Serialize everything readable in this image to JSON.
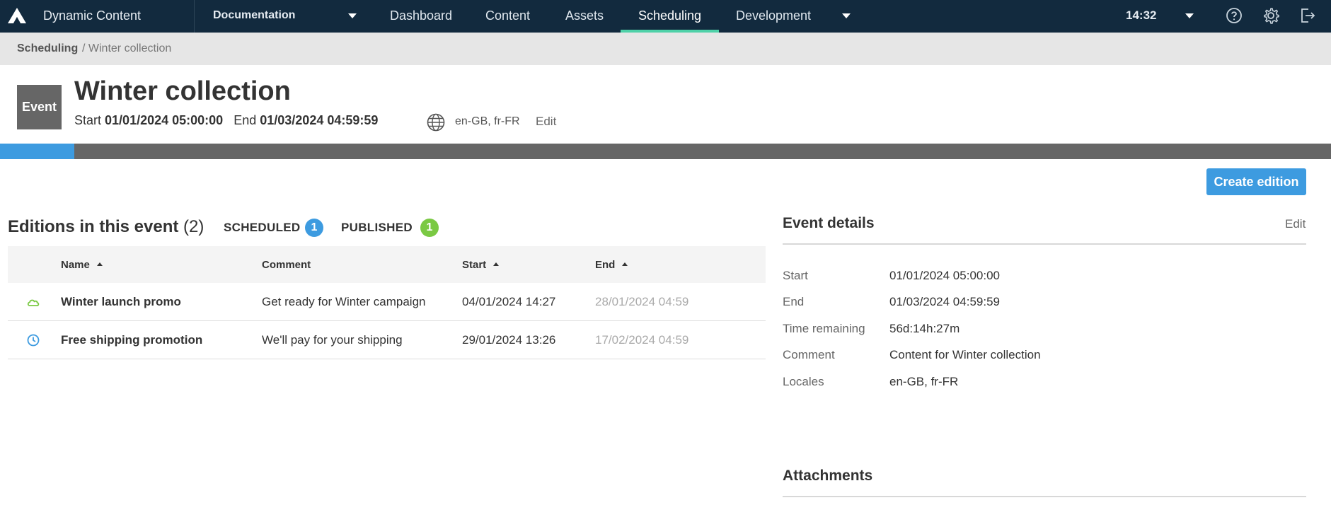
{
  "topbar": {
    "logo_icon": "amplience-logo-icon",
    "app_name": "Dynamic Content",
    "hub_name": "Documentation",
    "nav": [
      {
        "label": "Dashboard",
        "active": false
      },
      {
        "label": "Content",
        "active": false
      },
      {
        "label": "Assets",
        "active": false
      },
      {
        "label": "Scheduling",
        "active": true
      },
      {
        "label": "Development",
        "active": false
      }
    ],
    "clock": "14:32",
    "icons": [
      "help-icon",
      "settings-icon",
      "logout-icon"
    ]
  },
  "breadcrumb": {
    "root": "Scheduling",
    "current": "/ Winter collection"
  },
  "event": {
    "badge": "Event",
    "title": "Winter collection",
    "start_label": "Start",
    "start_value": "01/01/2024 05:00:00",
    "end_label": "End",
    "end_value": "01/03/2024 04:59:59",
    "locales": "en-GB, fr-FR",
    "edit_label": "Edit",
    "elapsed_fraction": 0.056
  },
  "actions": {
    "create_edition": "Create edition"
  },
  "editions": {
    "title": "Editions in this event",
    "count": "(2)",
    "scheduled_label": "SCHEDULED",
    "scheduled_count": "1",
    "published_label": "PUBLISHED",
    "published_count": "1",
    "columns": {
      "name": "Name",
      "comment": "Comment",
      "start": "Start",
      "end": "End"
    },
    "rows": [
      {
        "status_icon": "cloud-published-icon",
        "name": "Winter launch promo",
        "comment": "Get ready for Winter campaign",
        "start": "04/01/2024 14:27",
        "end": "28/01/2024 04:59"
      },
      {
        "status_icon": "clock-scheduled-icon",
        "name": "Free shipping promotion",
        "comment": "We'll pay for your shipping",
        "start": "29/01/2024 13:26",
        "end": "17/02/2024 04:59"
      }
    ]
  },
  "details": {
    "title": "Event details",
    "edit_label": "Edit",
    "items": [
      {
        "label": "Start",
        "value": "01/01/2024 05:00:00"
      },
      {
        "label": "End",
        "value": "01/03/2024 04:59:59"
      },
      {
        "label": "Time remaining",
        "value": "56d:14h:27m"
      },
      {
        "label": "Comment",
        "value": "Content for Winter collection"
      },
      {
        "label": "Locales",
        "value": "en-GB, fr-FR"
      }
    ]
  },
  "attachments": {
    "title": "Attachments"
  },
  "colors": {
    "topbar_bg": "#122a3e",
    "accent_blue": "#3d9be0",
    "published_green": "#7ac943",
    "nav_active_underline": "#4fd1a8"
  }
}
